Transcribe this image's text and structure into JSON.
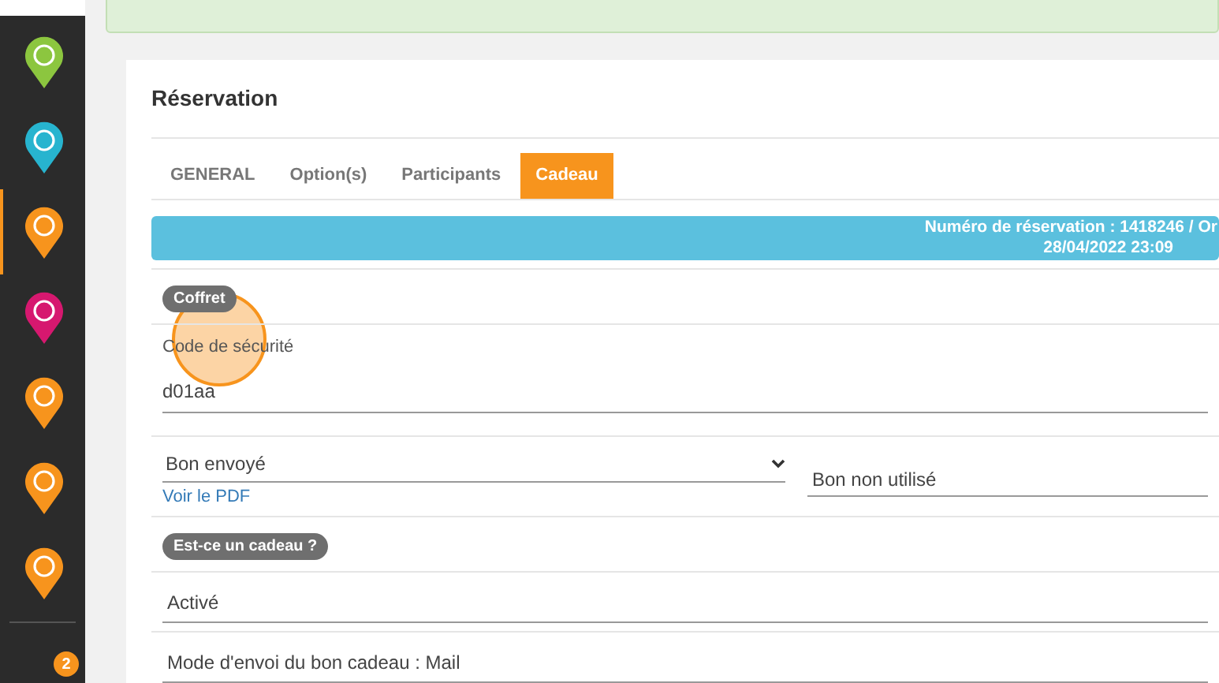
{
  "sidebar": {
    "items": [
      {
        "color": "#8cc63f",
        "selected": false
      },
      {
        "color": "#27b4cf",
        "selected": false
      },
      {
        "color": "#f7941d",
        "selected": true
      },
      {
        "color": "#d6186f",
        "selected": false
      },
      {
        "color": "#f7941d",
        "selected": false
      },
      {
        "color": "#f7941d",
        "selected": false
      },
      {
        "color": "#f7941d",
        "selected": false
      }
    ],
    "badge": "2"
  },
  "card": {
    "title": "Réservation",
    "tabs": [
      {
        "label": "GENERAL",
        "selected": false
      },
      {
        "label": "Option(s)",
        "selected": false
      },
      {
        "label": "Participants",
        "selected": false
      },
      {
        "label": "Cadeau",
        "selected": true
      }
    ],
    "banner": [
      "Numéro de réservation : 1418246 / Or",
      "28/04/2022 23:09"
    ],
    "sections": [
      {
        "kind": "tag",
        "label": "Coffret"
      },
      {
        "kind": "field",
        "label": "Code de sécurité",
        "value": "d01aa"
      },
      {
        "kind": "pair",
        "select": "Bon envoyé",
        "link": "Voir le PDF",
        "value": "Bon non utilisé"
      },
      {
        "kind": "tag",
        "label": "Est-ce un cadeau ?"
      },
      {
        "kind": "line",
        "value": "Activé"
      },
      {
        "kind": "line",
        "value": "Mode d'envoi du bon cadeau : Mail"
      }
    ]
  }
}
